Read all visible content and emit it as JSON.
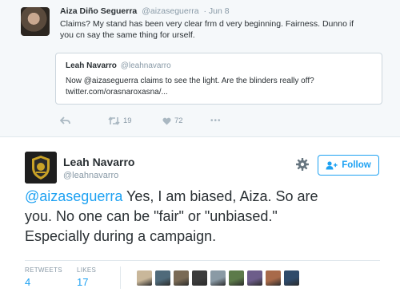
{
  "top_tweet": {
    "name": "Aiza Diño Seguerra",
    "handle": "@aizaseguerra",
    "date": "· Jun 8",
    "text_line1": "Claims? My stand has been very clear frm d very beginning. Fairness. Dunno if",
    "text_line2": "you cn say the same thing for urself.",
    "quote": {
      "name": "Leah Navarro",
      "handle": "@leahnavarro",
      "text_line1": "Now @aizaseguerra claims to see the light. Are the blinders really off?",
      "text_line2": "twitter.com/orasnaroxasna/..."
    },
    "actions": {
      "retweets": "19",
      "likes": "72",
      "more": "•••"
    }
  },
  "main_tweet": {
    "name": "Leah Navarro",
    "handle": "@leahnavarro",
    "follow_label": "Follow",
    "mention": "@aizaseguerra",
    "text_line1_rest": " Yes, I am biased, Aiza. So are",
    "text_line2": "you. No one can be \"fair\" or \"unbiased.\"",
    "text_line3": "Especially during a campaign.",
    "stats": {
      "retweets_label": "RETWEETS",
      "retweets_value": "4",
      "likes_label": "LIKES",
      "likes_value": "17"
    },
    "liker_colors": [
      "#c9b79a",
      "#4f6a7a",
      "#7a6a55",
      "#3c3c3c",
      "#8a9aa5",
      "#5c7a4a",
      "#6d5d8a",
      "#a86a4a",
      "#2e4a6a"
    ]
  },
  "colors": {
    "accent": "#1da1f2",
    "text": "#292f33",
    "muted": "#8899a6",
    "liked": "#e0245e"
  },
  "icons": [
    "reply-icon",
    "retweet-icon",
    "heart-icon",
    "more-icon",
    "gear-icon",
    "add-person-icon"
  ]
}
